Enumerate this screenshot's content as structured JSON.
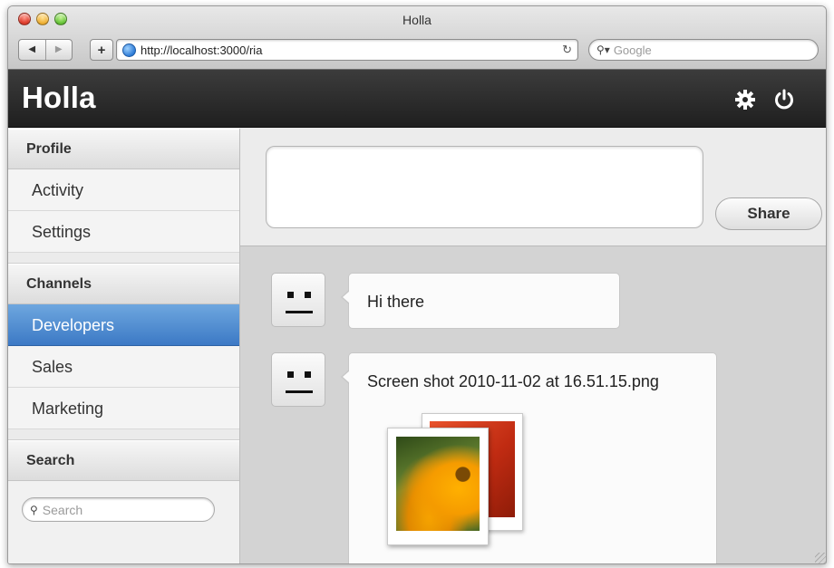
{
  "window": {
    "title": "Holla"
  },
  "browser": {
    "back_label": "◀",
    "forward_label": "▶",
    "add_label": "+",
    "url": "http://localhost:3000/ria",
    "reload_label": "C",
    "search_placeholder": "Google"
  },
  "app": {
    "title": "Holla",
    "icons": [
      "gear-icon",
      "power-icon"
    ]
  },
  "sidebar": {
    "profile": {
      "header": "Profile",
      "items": [
        "Activity",
        "Settings"
      ]
    },
    "channels": {
      "header": "Channels",
      "items": [
        "Developers",
        "Sales",
        "Marketing"
      ],
      "active": "Developers"
    },
    "search": {
      "header": "Search",
      "placeholder": "Search"
    }
  },
  "composer": {
    "value": "",
    "share_label": "Share"
  },
  "messages": [
    {
      "text": "Hi there"
    },
    {
      "text": "Screen shot 2010-11-02 at 16.51.15.png"
    }
  ],
  "colors": {
    "header_bg": "#262626",
    "active_item": "#4f8ad0",
    "main_bg": "#d3d3d3"
  }
}
